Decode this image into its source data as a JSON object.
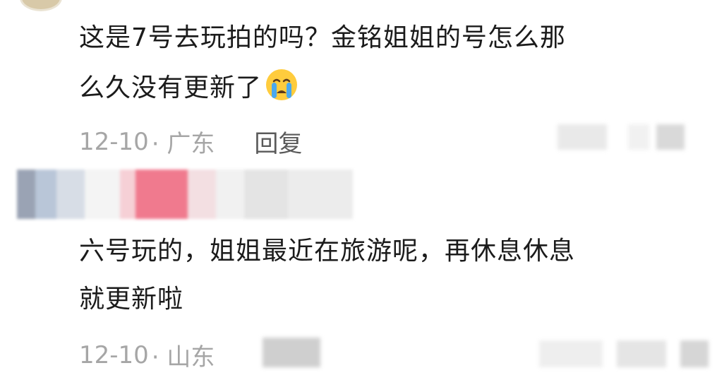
{
  "comment": {
    "text_line1": "这是7号去玩拍的吗？金铭姐姐的号怎么那",
    "text_line2": "么久没有更新了",
    "emoji": "crying-face-emoji",
    "date": "12-10",
    "location": "· 广东",
    "reply_label": "回复"
  },
  "reply": {
    "text_line1": "六号玩的，姐姐最近在旅游呢，再休息休息",
    "text_line2": "就更新啦",
    "date": "12-10",
    "location": "· 山东"
  },
  "colors": {
    "text": "#1b1b1b",
    "meta": "#a6a6a6",
    "reply": "#5a5a5a",
    "pink_blur": "#f07a8e"
  }
}
